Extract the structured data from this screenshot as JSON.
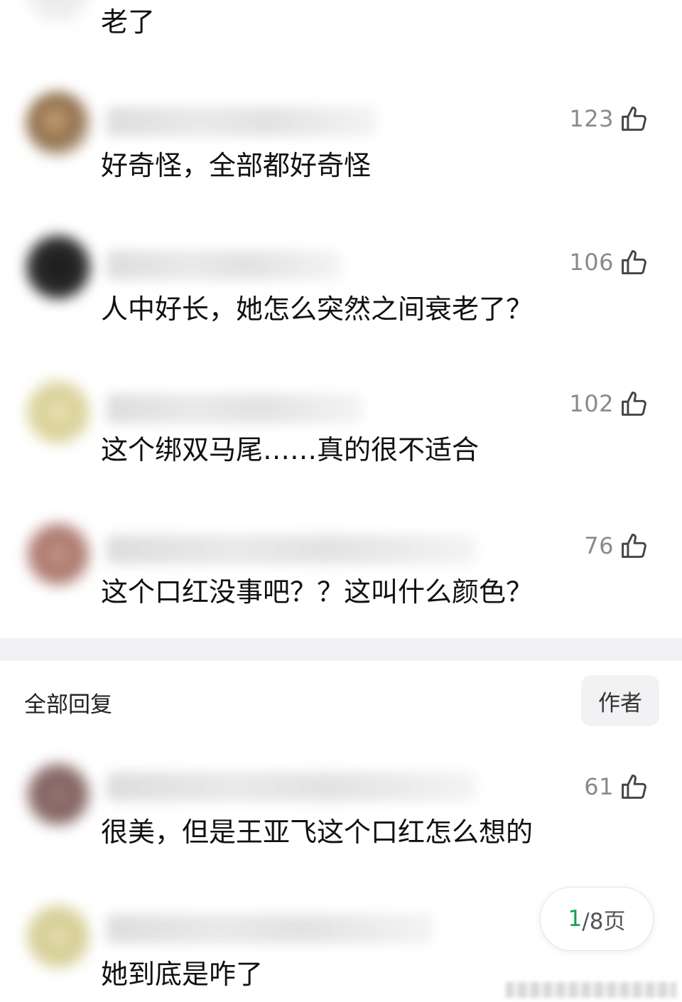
{
  "comments": [
    {
      "text": "老了"
    },
    {
      "likes": "123",
      "text": "好奇怪，全部都好奇怪"
    },
    {
      "likes": "106",
      "text": "人中好长，她怎么突然之间衰老了？"
    },
    {
      "likes": "102",
      "text": "这个绑双马尾……真的很不适合"
    },
    {
      "likes": "76",
      "text": "这个口红没事吧？？这叫什么颜色？"
    }
  ],
  "replies_section": {
    "title": "全部回复",
    "author_filter_label": "作者"
  },
  "replies": [
    {
      "likes": "61",
      "text": "很美，但是王亚飞这个口红怎么想的"
    },
    {
      "text": "她到底是咋了"
    }
  ],
  "pager": {
    "current": "1",
    "rest": "/8页"
  },
  "colors": {
    "accent": "#12a150",
    "like_count": "#8a8a8a",
    "divider": "#f1f1f3"
  }
}
